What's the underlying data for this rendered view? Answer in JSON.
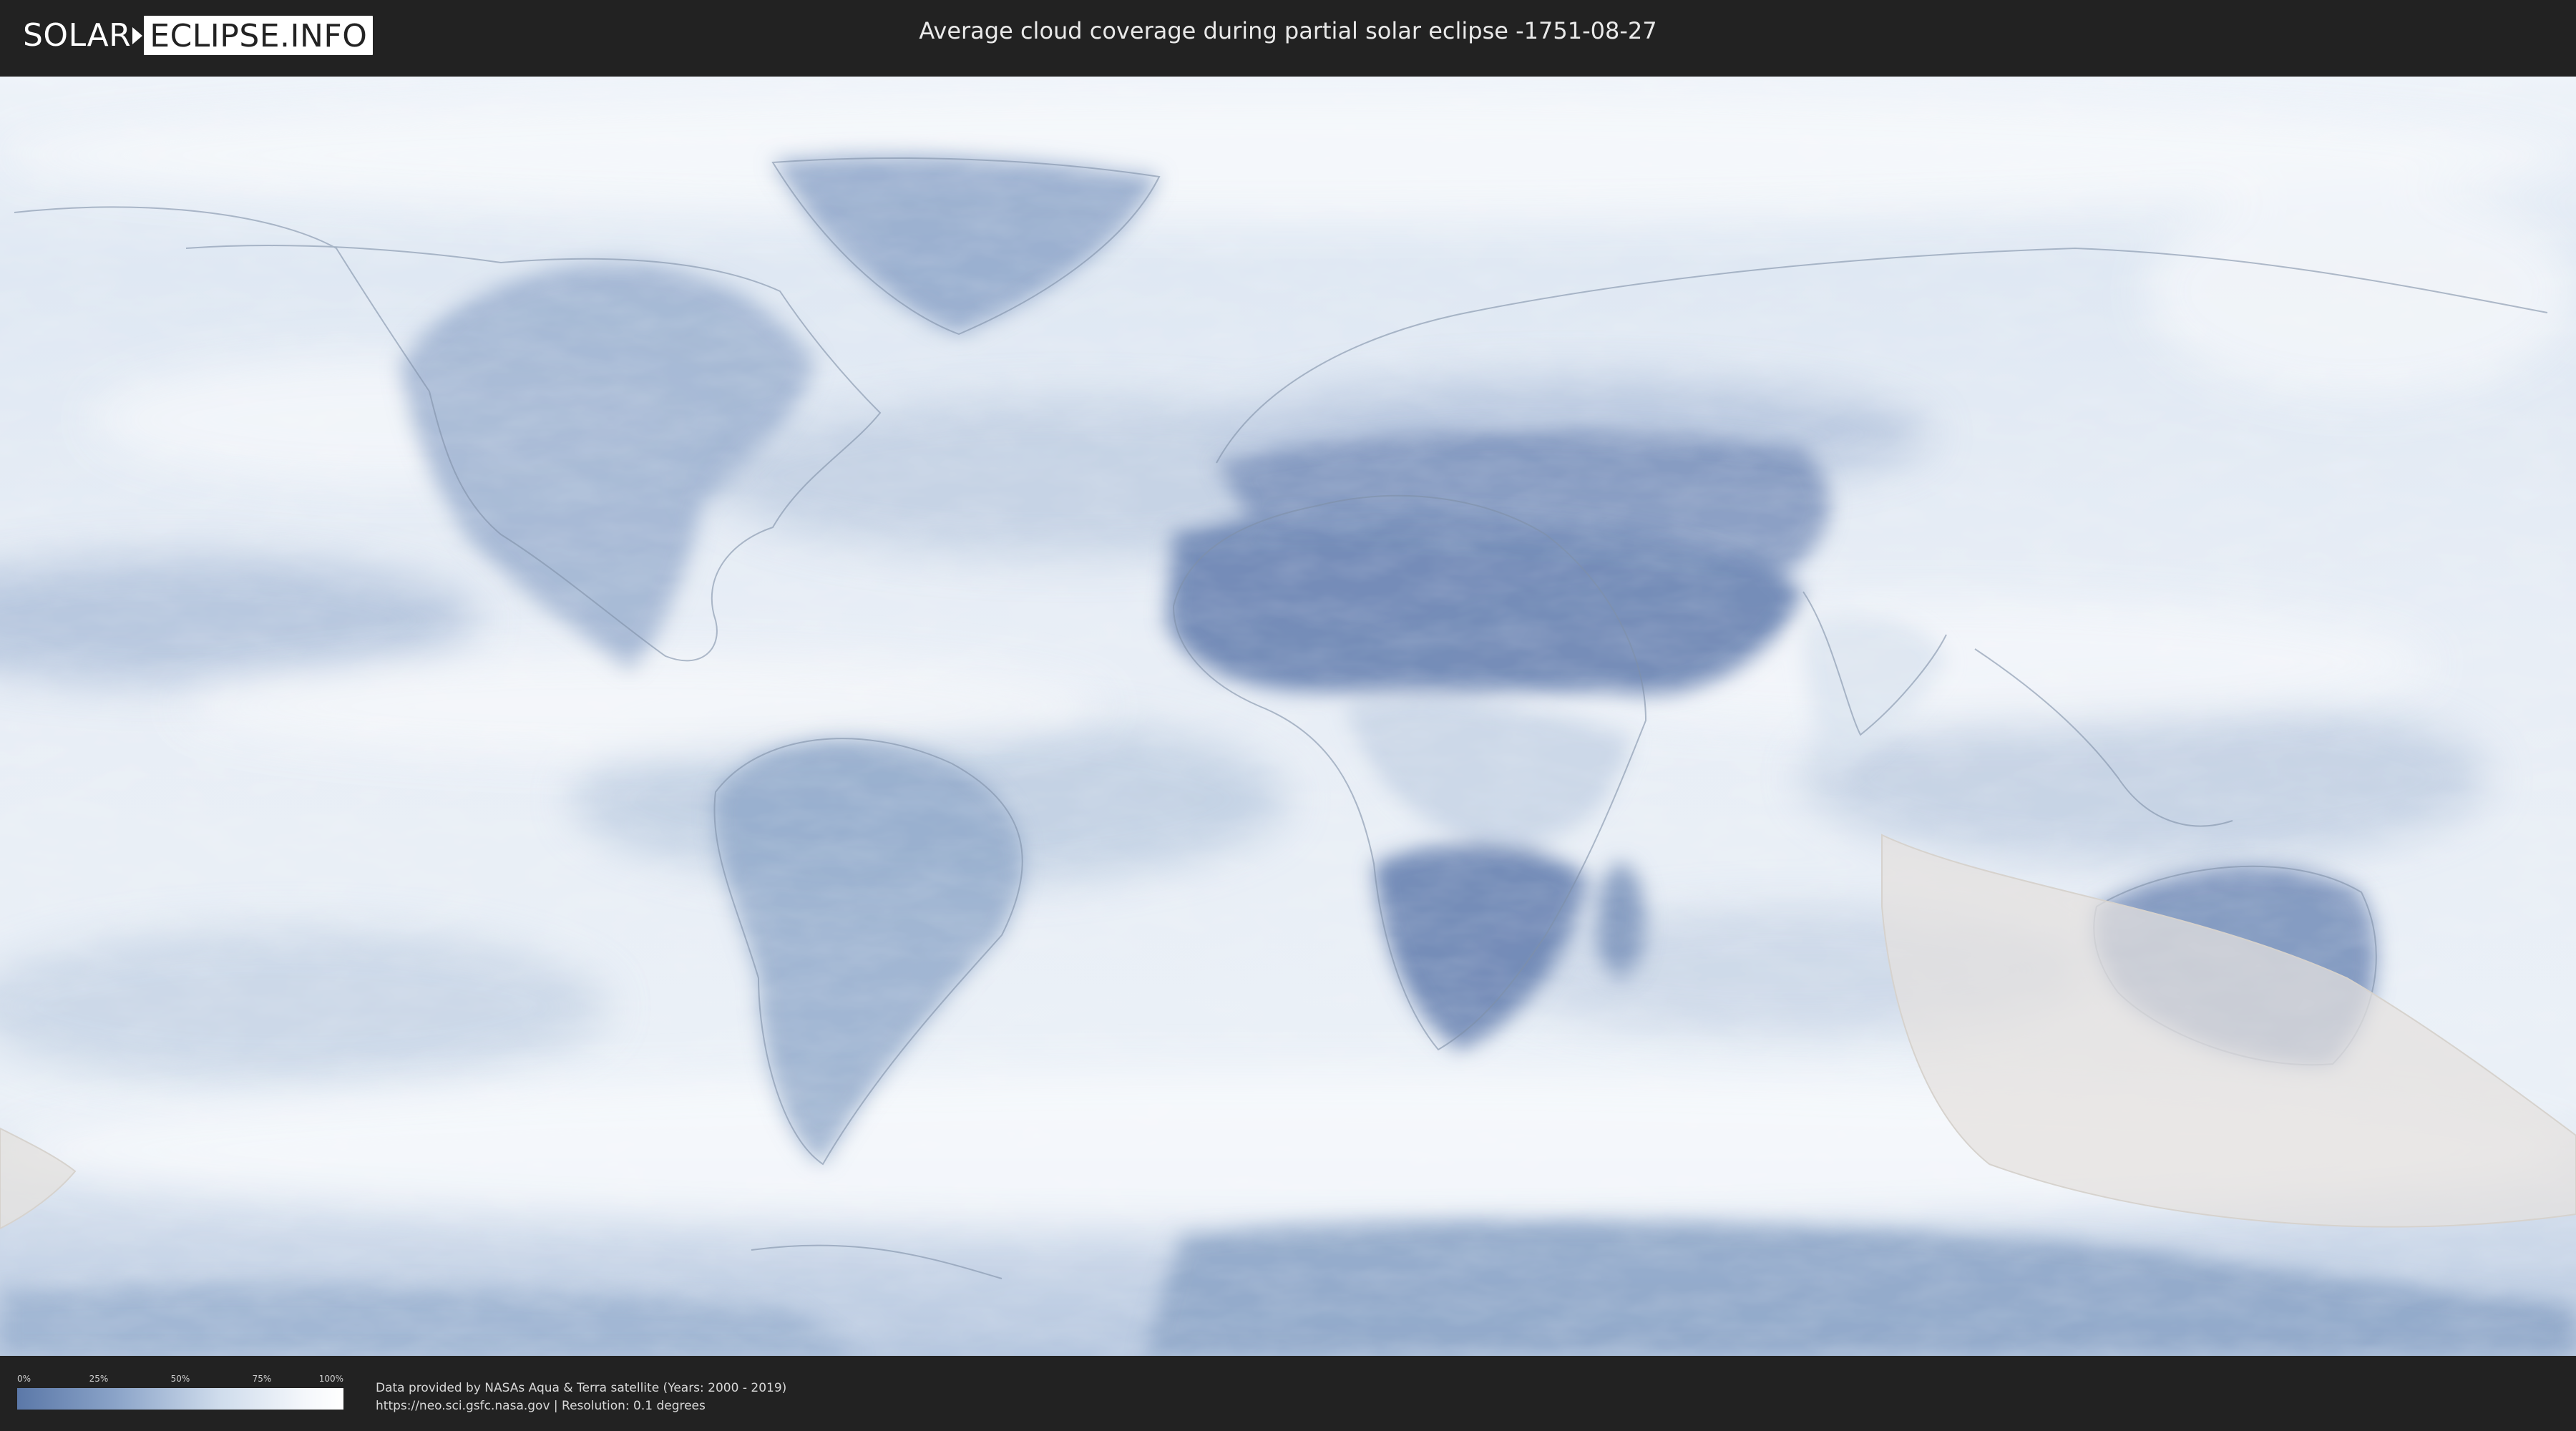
{
  "header": {
    "logo_left": "SOLAR",
    "logo_right": "ECLIPSE.INFO",
    "title": "Average cloud coverage during partial solar eclipse -1751-08-27"
  },
  "map": {
    "projection": "equirectangular world map",
    "layer": "average cloud coverage",
    "eclipse_shadow_color": "#e4e1de",
    "cloud_low_color": "#5b78a8",
    "cloud_high_color": "#ffffff"
  },
  "legend": {
    "ticks": [
      "0%",
      "25%",
      "50%",
      "75%",
      "100%"
    ],
    "gradient_colors": [
      "#5b78a8",
      "#8aa3c8",
      "#cfdcec",
      "#f4f7fb",
      "#ffffff"
    ]
  },
  "footer": {
    "credit_line1": "Data provided by NASAs Aqua & Terra satellite (Years: 2000 - 2019)",
    "credit_line2": "https://neo.sci.gsfc.nasa.gov | Resolution: 0.1 degrees"
  }
}
